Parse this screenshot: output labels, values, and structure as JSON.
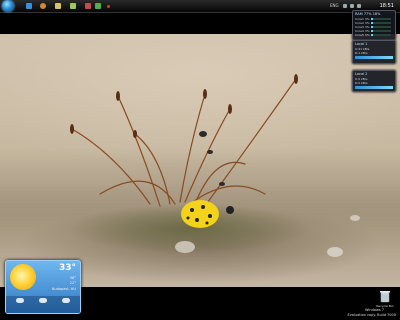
{
  "taskbar": {
    "language": "ENG",
    "clock": "18:51",
    "pinned_icons": [
      {
        "name": "ie-icon",
        "color": "#3b8fd8"
      },
      {
        "name": "media-icon",
        "color": "#d38b2c"
      },
      {
        "name": "folder-icon",
        "color": "#d7c26a"
      },
      {
        "name": "app-icon",
        "color": "#9ec85a"
      },
      {
        "name": "player-icon",
        "color": "#c24b4b"
      },
      {
        "name": "green-icon",
        "color": "#4caf50"
      },
      {
        "name": "red-icon",
        "color": "#d33"
      }
    ]
  },
  "gadgets": {
    "cpu": {
      "title": "RAM 77%  18%",
      "cores": [
        {
          "label": "Core1",
          "value": "3%",
          "fill": 0.08
        },
        {
          "label": "Core2",
          "value": "3%",
          "fill": 0.08
        },
        {
          "label": "Core3",
          "value": "3%",
          "fill": 0.08
        },
        {
          "label": "Core4",
          "value": "3%",
          "fill": 0.08
        },
        {
          "label": "Core5",
          "value": "3%",
          "fill": 0.08
        }
      ]
    },
    "net1": {
      "title": "Local 1",
      "line1": "U:41 kB/s  ",
      "line2": "D:1 kB/s"
    },
    "net2": {
      "title": "Local 2",
      "line1": "U:0 kB/s",
      "line2": "D:0 kB/s"
    }
  },
  "weather": {
    "temperature": "33°",
    "hi": "38°",
    "lo": "22°",
    "city": "Budapest, HU",
    "forecast": [
      {
        "day": "",
        "hi": "",
        "lo": ""
      },
      {
        "day": "",
        "hi": "",
        "lo": ""
      },
      {
        "day": "",
        "hi": "",
        "lo": ""
      }
    ]
  },
  "desktop": {
    "recycle_bin_label": "Recycle Bin",
    "build_text": "Evaluation copy. Build 7000",
    "os_label": "Windows 7"
  }
}
